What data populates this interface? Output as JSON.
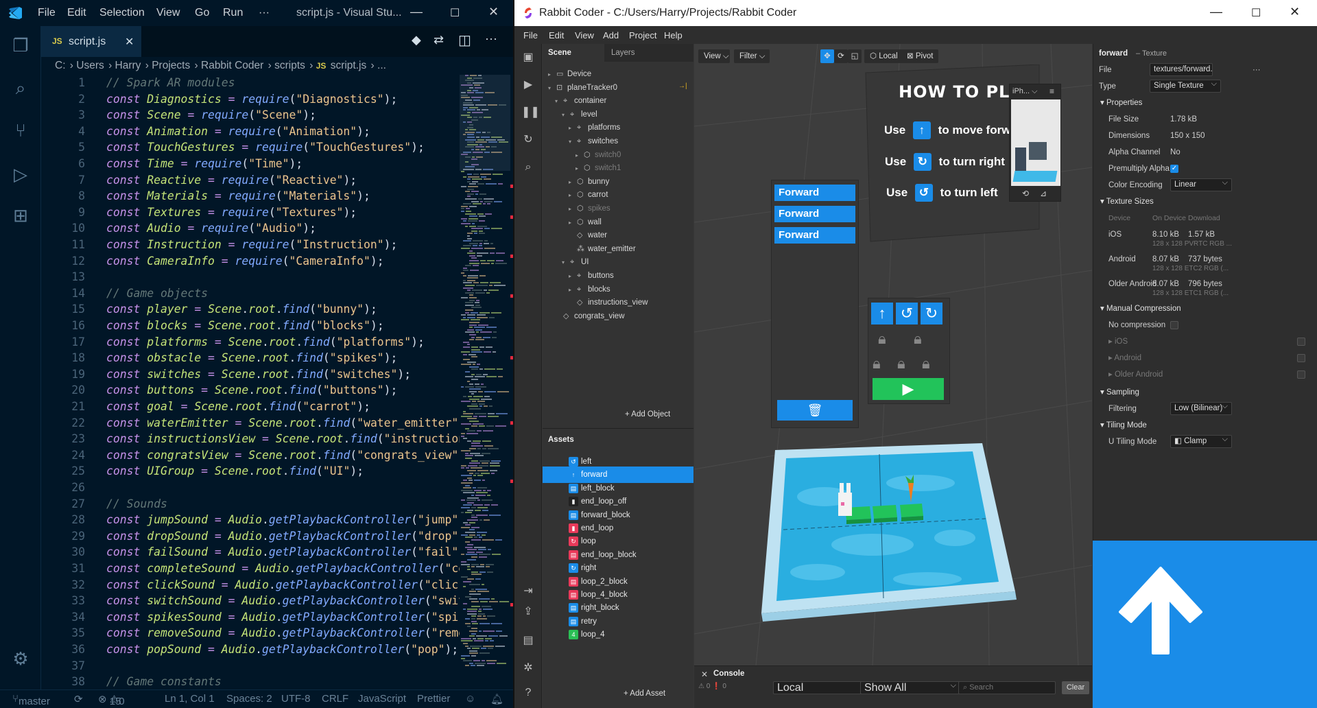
{
  "vscode": {
    "title_menu": [
      "File",
      "Edit",
      "Selection",
      "View",
      "Go",
      "Run",
      "···"
    ],
    "window_title": "script.js - Visual Stu...",
    "tab_label": "script.js",
    "tab_type": "JS",
    "breadcrumb": [
      "C:",
      "Users",
      "Harry",
      "Projects",
      "Rabbit Coder",
      "scripts",
      "script.js",
      "..."
    ],
    "lines": [
      {
        "n": "1",
        "c": "// Spark AR modules",
        "t": "comment"
      },
      {
        "n": "2",
        "var": "Diagnostics",
        "call": "require",
        "arg": "\"Diagnostics\""
      },
      {
        "n": "3",
        "var": "Scene",
        "call": "require",
        "arg": "\"Scene\""
      },
      {
        "n": "4",
        "var": "Animation",
        "call": "require",
        "arg": "\"Animation\""
      },
      {
        "n": "5",
        "var": "TouchGestures",
        "call": "require",
        "arg": "\"TouchGestures\""
      },
      {
        "n": "6",
        "var": "Time",
        "call": "require",
        "arg": "\"Time\""
      },
      {
        "n": "7",
        "var": "Reactive",
        "call": "require",
        "arg": "\"Reactive\""
      },
      {
        "n": "8",
        "var": "Materials",
        "call": "require",
        "arg": "\"Materials\""
      },
      {
        "n": "9",
        "var": "Textures",
        "call": "require",
        "arg": "\"Textures\""
      },
      {
        "n": "10",
        "var": "Audio",
        "call": "require",
        "arg": "\"Audio\""
      },
      {
        "n": "11",
        "var": "Instruction",
        "call": "require",
        "arg": "\"Instruction\""
      },
      {
        "n": "12",
        "var": "CameraInfo",
        "call": "require",
        "arg": "\"CameraInfo\""
      },
      {
        "n": "13",
        "c": "",
        "t": "blank"
      },
      {
        "n": "14",
        "c": "// Game objects",
        "t": "comment"
      },
      {
        "n": "15",
        "var": "player",
        "obj": "Scene.root.",
        "call": "find",
        "arg": "\"bunny\""
      },
      {
        "n": "16",
        "var": "blocks",
        "obj": "Scene.root.",
        "call": "find",
        "arg": "\"blocks\""
      },
      {
        "n": "17",
        "var": "platforms",
        "obj": "Scene.root.",
        "call": "find",
        "arg": "\"platforms\""
      },
      {
        "n": "18",
        "var": "obstacle",
        "obj": "Scene.root.",
        "call": "find",
        "arg": "\"spikes\""
      },
      {
        "n": "19",
        "var": "switches",
        "obj": "Scene.root.",
        "call": "find",
        "arg": "\"switches\""
      },
      {
        "n": "20",
        "var": "buttons",
        "obj": "Scene.root.",
        "call": "find",
        "arg": "\"buttons\""
      },
      {
        "n": "21",
        "var": "goal",
        "obj": "Scene.root.",
        "call": "find",
        "arg": "\"carrot\""
      },
      {
        "n": "22",
        "var": "waterEmitter",
        "obj": "Scene.root.",
        "call": "find",
        "arg": "\"water_emitter\""
      },
      {
        "n": "23",
        "var": "instructionsView",
        "obj": "Scene.root.",
        "call": "find",
        "arg": "\"instructions"
      },
      {
        "n": "24",
        "var": "congratsView",
        "obj": "Scene.root.",
        "call": "find",
        "arg": "\"congrats_view\""
      },
      {
        "n": "25",
        "var": "UIGroup",
        "obj": "Scene.root.",
        "call": "find",
        "arg": "\"UI\""
      },
      {
        "n": "26",
        "c": "",
        "t": "blank"
      },
      {
        "n": "27",
        "c": "// Sounds",
        "t": "comment"
      },
      {
        "n": "28",
        "var": "jumpSound",
        "obj": "Audio.",
        "call": "getPlaybackController",
        "arg": "\"jump\""
      },
      {
        "n": "29",
        "var": "dropSound",
        "obj": "Audio.",
        "call": "getPlaybackController",
        "arg": "\"drop\""
      },
      {
        "n": "30",
        "var": "failSound",
        "obj": "Audio.",
        "call": "getPlaybackController",
        "arg": "\"fail\""
      },
      {
        "n": "31",
        "var": "completeSound",
        "obj": "Audio.",
        "call": "getPlaybackController",
        "arg": "\"cor"
      },
      {
        "n": "32",
        "var": "clickSound",
        "obj": "Audio.",
        "call": "getPlaybackController",
        "arg": "\"click'"
      },
      {
        "n": "33",
        "var": "switchSound",
        "obj": "Audio.",
        "call": "getPlaybackController",
        "arg": "\"swit"
      },
      {
        "n": "34",
        "var": "spikesSound",
        "obj": "Audio.",
        "call": "getPlaybackController",
        "arg": "\"spik"
      },
      {
        "n": "35",
        "var": "removeSound",
        "obj": "Audio.",
        "call": "getPlaybackController",
        "arg": "\"remov"
      },
      {
        "n": "36",
        "var": "popSound",
        "obj": "Audio.",
        "call": "getPlaybackController",
        "arg": "\"pop\""
      },
      {
        "n": "37",
        "c": "",
        "t": "blank"
      },
      {
        "n": "38",
        "c": "// Game constants",
        "t": "comment"
      }
    ],
    "status": {
      "branch": "master",
      "errors": "15",
      "warnings": "0",
      "position": "Ln 1, Col 1",
      "spaces": "Spaces: 2",
      "encoding": "UTF-8",
      "eol": "CRLF",
      "language": "JavaScript",
      "formatter": "Prettier"
    }
  },
  "spark": {
    "window_title": "Rabbit Coder - C:/Users/Harry/Projects/Rabbit Coder",
    "menu": [
      "File",
      "Edit",
      "View",
      "Add",
      "Project",
      "Help"
    ],
    "scene_tabs": [
      "Scene",
      "Layers"
    ],
    "tree": [
      {
        "label": "Device",
        "depth": 0,
        "tri": "▸",
        "icon": "▭",
        "dim": false
      },
      {
        "label": "planeTracker0",
        "depth": 0,
        "tri": "▾",
        "icon": "⊡",
        "dim": false
      },
      {
        "label": "container",
        "depth": 1,
        "tri": "▾",
        "icon": "⌖",
        "dim": false
      },
      {
        "label": "level",
        "depth": 2,
        "tri": "▾",
        "icon": "⌖",
        "dim": false
      },
      {
        "label": "platforms",
        "depth": 3,
        "tri": "▸",
        "icon": "⌖",
        "dim": false
      },
      {
        "label": "switches",
        "depth": 3,
        "tri": "▾",
        "icon": "⌖",
        "dim": false
      },
      {
        "label": "switch0",
        "depth": 4,
        "tri": "▸",
        "icon": "⬡",
        "dim": true
      },
      {
        "label": "switch1",
        "depth": 4,
        "tri": "▸",
        "icon": "⬡",
        "dim": true
      },
      {
        "label": "bunny",
        "depth": 3,
        "tri": "▸",
        "icon": "⬡",
        "dim": false
      },
      {
        "label": "carrot",
        "depth": 3,
        "tri": "▸",
        "icon": "⬡",
        "dim": false
      },
      {
        "label": "spikes",
        "depth": 3,
        "tri": "▸",
        "icon": "⬡",
        "dim": true
      },
      {
        "label": "wall",
        "depth": 3,
        "tri": "▸",
        "icon": "⬡",
        "dim": false
      },
      {
        "label": "water",
        "depth": 3,
        "tri": "",
        "icon": "◇",
        "dim": false
      },
      {
        "label": "water_emitter",
        "depth": 3,
        "tri": "",
        "icon": "⁂",
        "dim": false
      },
      {
        "label": "UI",
        "depth": 2,
        "tri": "▾",
        "icon": "⌖",
        "dim": false
      },
      {
        "label": "buttons",
        "depth": 3,
        "tri": "▸",
        "icon": "⌖",
        "dim": false
      },
      {
        "label": "blocks",
        "depth": 3,
        "tri": "▸",
        "icon": "⌖",
        "dim": false
      },
      {
        "label": "instructions_view",
        "depth": 3,
        "tri": "",
        "icon": "◇",
        "dim": false
      },
      {
        "label": "congrats_view",
        "depth": 1,
        "tri": "",
        "icon": "◇",
        "dim": false
      }
    ],
    "add_object": "+ Add Object",
    "assets_title": "Assets",
    "assets": [
      {
        "label": "left",
        "icon": "↺",
        "color": "#1a8ce8"
      },
      {
        "label": "forward",
        "icon": "↑",
        "color": "#1a8ce8",
        "sel": true
      },
      {
        "label": "left_block",
        "icon": "▤",
        "color": "#1a8ce8"
      },
      {
        "label": "end_loop_off",
        "icon": "▮",
        "color": "#222"
      },
      {
        "label": "forward_block",
        "icon": "▤",
        "color": "#1a8ce8"
      },
      {
        "label": "end_loop",
        "icon": "▮",
        "color": "#e83a5a"
      },
      {
        "label": "loop",
        "icon": "↻",
        "color": "#e83a5a"
      },
      {
        "label": "end_loop_block",
        "icon": "▤",
        "color": "#e83a5a"
      },
      {
        "label": "right",
        "icon": "↻",
        "color": "#1a8ce8"
      },
      {
        "label": "loop_2_block",
        "icon": "▤",
        "color": "#e83a5a"
      },
      {
        "label": "loop_4_block",
        "icon": "▤",
        "color": "#e83a5a"
      },
      {
        "label": "right_block",
        "icon": "▤",
        "color": "#1a8ce8"
      },
      {
        "label": "retry",
        "icon": "▤",
        "color": "#1a8ce8"
      },
      {
        "label": "loop_4",
        "icon": "4",
        "color": "#2bbf55"
      }
    ],
    "add_asset": "+ Add Asset",
    "vp_toolbar": {
      "view": "View",
      "filter": "Filter",
      "local": "Local",
      "pivot": "Pivot",
      "device": "iPh..."
    },
    "howto": {
      "title": "HOW TO PLAY",
      "use": "Use",
      "move_forward": "to move forward",
      "turn_right": "to turn right",
      "turn_left": "to turn left"
    },
    "code_blocks": [
      "Forward",
      "Forward",
      "Forward"
    ],
    "console": {
      "title": "Console",
      "w0": "0",
      "w1": "0",
      "filter_local": "Local",
      "filter_show": "Show All",
      "search_placeholder": "Search",
      "clear": "Clear"
    },
    "inspector": {
      "name": "forward",
      "type_suffix": "– Texture",
      "file_label": "File",
      "file_value": "textures/forward.png",
      "type_label": "Type",
      "type_value": "Single Texture",
      "properties": "Properties",
      "file_size_label": "File Size",
      "file_size": "1.78 kB",
      "dims_label": "Dimensions",
      "dims": "150 x 150",
      "alpha_label": "Alpha Channel",
      "alpha": "No",
      "premult_label": "Premultiply Alpha",
      "encoding_label": "Color Encoding",
      "encoding": "Linear",
      "tex_sizes": "Texture Sizes",
      "col_device": "Device",
      "col_on": "On Device",
      "col_dl": "Download",
      "ios_label": "iOS",
      "ios_on": "8.10 kB",
      "ios_dl": "1.57 kB",
      "ios_sub": "128 x 128 PVRTC RGB ...",
      "and_label": "Android",
      "and_on": "8.07 kB",
      "and_dl": "737 bytes",
      "and_sub": "128 x 128 ETC2 RGB (...",
      "old_label": "Older Android",
      "old_on": "8.07 kB",
      "old_dl": "796 bytes",
      "old_sub": "128 x 128 ETC1 RGB (...",
      "manual": "Manual Compression",
      "nocomp": "No compression",
      "m_ios": "iOS",
      "m_and": "Android",
      "m_old": "Older Android",
      "sampling": "Sampling",
      "filtering_label": "Filtering",
      "filtering": "Low (Bilinear)",
      "tiling": "Tiling Mode",
      "utile_label": "U Tiling Mode",
      "utile": "Clamp"
    }
  }
}
